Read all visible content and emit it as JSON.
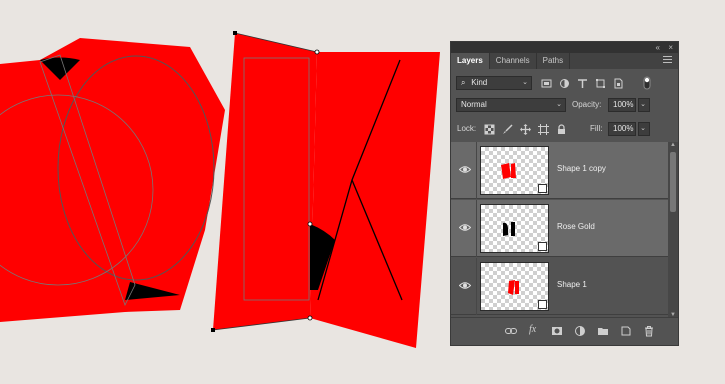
{
  "panel": {
    "tabs": [
      "Layers",
      "Channels",
      "Paths"
    ],
    "active_tab": "Layers",
    "filter": {
      "kind_label": "Kind"
    },
    "blend_mode": "Normal",
    "opacity_label": "Opacity:",
    "opacity_value": "100%",
    "lock_label": "Lock:",
    "fill_label": "Fill:",
    "fill_value": "100%",
    "layers": [
      {
        "name": "Shape 1 copy",
        "selected": true
      },
      {
        "name": "Rose Gold",
        "selected": true
      },
      {
        "name": "Shape 1",
        "selected": false
      }
    ]
  },
  "colors": {
    "canvas_bg": "#e9e5e1",
    "shape_red": "#ff0000",
    "panel_bg": "#535353",
    "selected_row": "#6a6a6a"
  },
  "icons": {
    "top": [
      "collapse-icon",
      "close-icon",
      "panel-menu-icon"
    ],
    "filter": [
      "search-icon",
      "image-filter-icon",
      "adjustment-filter-icon",
      "type-filter-icon",
      "shape-filter-icon",
      "smart-object-filter-icon",
      "filter-toggle-icon"
    ],
    "lock": [
      "lock-transparent-icon",
      "lock-brush-icon",
      "lock-move-icon",
      "lock-artboard-icon",
      "lock-all-icon"
    ],
    "bottom": [
      "link-icon",
      "fx-icon",
      "mask-icon",
      "adjustment-icon",
      "group-folder-icon",
      "new-layer-icon",
      "trash-icon"
    ]
  }
}
